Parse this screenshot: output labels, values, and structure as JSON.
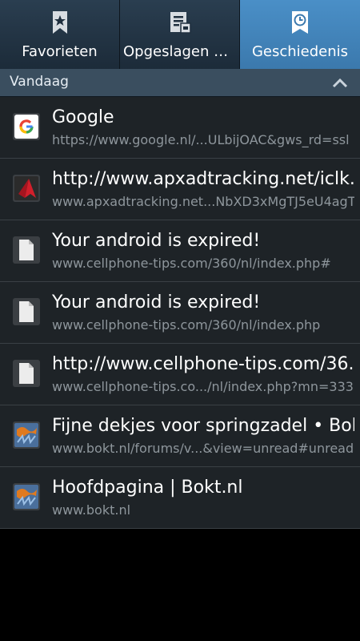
{
  "tabs": [
    {
      "label": "Favorieten",
      "icon": "star-bookmark-icon",
      "active": false
    },
    {
      "label": "Opgeslagen pa..",
      "icon": "saved-pages-icon",
      "active": false
    },
    {
      "label": "Geschiedenis",
      "icon": "history-clock-icon",
      "active": true
    }
  ],
  "section": {
    "title": "Vandaag",
    "toggle_icon": "chevron-up-icon"
  },
  "history": [
    {
      "title": "Google",
      "url": "https://www.google.nl/...ULbijOAC&gws_rd=ssl",
      "icon": "google-icon"
    },
    {
      "title": "http://www.apxadtracking.net/iclk...",
      "url": "www.apxadtracking.net...NbXD3xMgTJ5eU4agT",
      "icon": "apx-icon"
    },
    {
      "title": "Your android is expired!",
      "url": "www.cellphone-tips.com/360/nl/index.php#",
      "icon": "page-icon"
    },
    {
      "title": "Your android is expired!",
      "url": "www.cellphone-tips.com/360/nl/index.php",
      "icon": "page-icon"
    },
    {
      "title": "http://www.cellphone-tips.com/36...",
      "url": "www.cellphone-tips.co.../nl/index.php?mn=333",
      "icon": "page-icon"
    },
    {
      "title": "Fijne dekjes voor springzadel • Bok...",
      "url": "www.bokt.nl/forums/v...&view=unread#unread",
      "icon": "bokt-icon"
    },
    {
      "title": "Hoofdpagina | Bokt.nl",
      "url": "www.bokt.nl",
      "icon": "bokt-icon"
    }
  ],
  "colors": {
    "active_tab": "#3b79ad",
    "tab": "#1c2b39",
    "section": "#3a4e5f",
    "list_bg": "#1e2327"
  }
}
